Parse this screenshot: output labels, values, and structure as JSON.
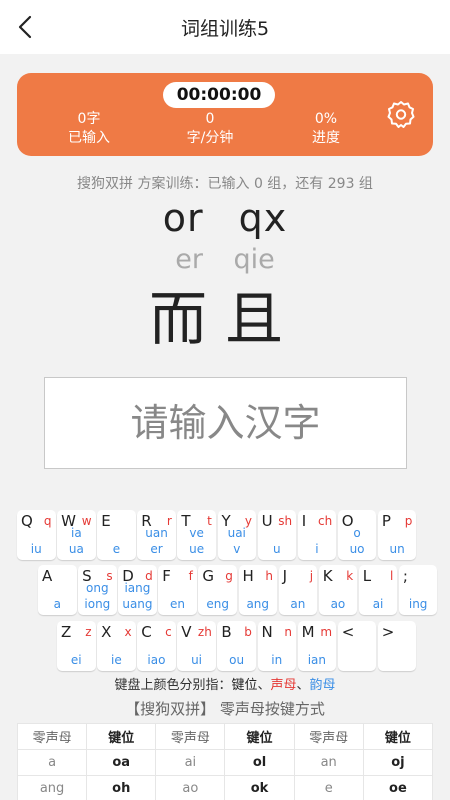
{
  "header": {
    "title": "词组训练5",
    "back_icon": "back-arrow-icon"
  },
  "stats": {
    "timer": "00:00:00",
    "typed_value": "0字",
    "typed_label": "已输入",
    "speed_value": "0",
    "speed_label": "字/分钟",
    "progress_value": "0%",
    "progress_label": "进度",
    "settings_icon": "gear-icon",
    "accent_color": "#ef7a45"
  },
  "practice": {
    "info": "搜狗双拼 方案训练：已输入 0 组，还有 293 组",
    "codes": "or qx",
    "pinyin": "er qie",
    "hanzi": "而且"
  },
  "input": {
    "placeholder": "请输入汉字"
  },
  "keyboard": {
    "rows": [
      [
        {
          "key": "Q",
          "sheng": "q",
          "yun": [
            "iu"
          ]
        },
        {
          "key": "W",
          "sheng": "w",
          "yun": [
            "ia",
            "ua"
          ]
        },
        {
          "key": "E",
          "sheng": "",
          "yun": [
            "e"
          ]
        },
        {
          "key": "R",
          "sheng": "r",
          "yun": [
            "uan",
            "er"
          ]
        },
        {
          "key": "T",
          "sheng": "t",
          "yun": [
            "ve",
            "ue"
          ]
        },
        {
          "key": "Y",
          "sheng": "y",
          "yun": [
            "uai",
            "v"
          ]
        },
        {
          "key": "U",
          "sheng": "sh",
          "yun": [
            "u"
          ]
        },
        {
          "key": "I",
          "sheng": "ch",
          "yun": [
            "i"
          ]
        },
        {
          "key": "O",
          "sheng": "",
          "yun": [
            "o",
            "uo"
          ]
        },
        {
          "key": "P",
          "sheng": "p",
          "yun": [
            "un"
          ]
        }
      ],
      [
        {
          "key": "A",
          "sheng": "",
          "yun": [
            "a"
          ]
        },
        {
          "key": "S",
          "sheng": "s",
          "yun": [
            "ong",
            "iong"
          ]
        },
        {
          "key": "D",
          "sheng": "d",
          "yun": [
            "iang",
            "uang"
          ]
        },
        {
          "key": "F",
          "sheng": "f",
          "yun": [
            "en"
          ]
        },
        {
          "key": "G",
          "sheng": "g",
          "yun": [
            "eng"
          ]
        },
        {
          "key": "H",
          "sheng": "h",
          "yun": [
            "ang"
          ]
        },
        {
          "key": "J",
          "sheng": "j",
          "yun": [
            "an"
          ]
        },
        {
          "key": "K",
          "sheng": "k",
          "yun": [
            "ao"
          ]
        },
        {
          "key": "L",
          "sheng": "l",
          "yun": [
            "ai"
          ]
        },
        {
          "key": ";",
          "sheng": "",
          "yun": [
            "ing"
          ]
        }
      ],
      [
        {
          "key": "Z",
          "sheng": "z",
          "yun": [
            "ei"
          ]
        },
        {
          "key": "X",
          "sheng": "x",
          "yun": [
            "ie"
          ]
        },
        {
          "key": "C",
          "sheng": "c",
          "yun": [
            "iao"
          ]
        },
        {
          "key": "V",
          "sheng": "zh",
          "yun": [
            "ui"
          ]
        },
        {
          "key": "B",
          "sheng": "b",
          "yun": [
            "ou"
          ]
        },
        {
          "key": "N",
          "sheng": "n",
          "yun": [
            "in"
          ]
        },
        {
          "key": "M",
          "sheng": "m",
          "yun": [
            "ian"
          ]
        },
        {
          "key": "<",
          "sheng": "",
          "yun": []
        },
        {
          "key": ">",
          "sheng": "",
          "yun": []
        }
      ]
    ],
    "colors": {
      "key": "#222222",
      "sheng": "#e53935",
      "yun": "#3a8ee6"
    }
  },
  "legend": {
    "prefix": "键盘上颜色分别指：",
    "key_label": "键位",
    "sep1": "、",
    "sheng_label": "声母",
    "sep2": "、",
    "yun_label": "韵母"
  },
  "scheme_title": "【搜狗双拼】 零声母按键方式",
  "zero_table": {
    "headers": [
      "零声母",
      "键位",
      "零声母",
      "键位",
      "零声母",
      "键位"
    ],
    "rows": [
      [
        "a",
        "oa",
        "ai",
        "ol",
        "an",
        "oj"
      ],
      [
        "ang",
        "oh",
        "ao",
        "ok",
        "e",
        "oe"
      ]
    ]
  }
}
